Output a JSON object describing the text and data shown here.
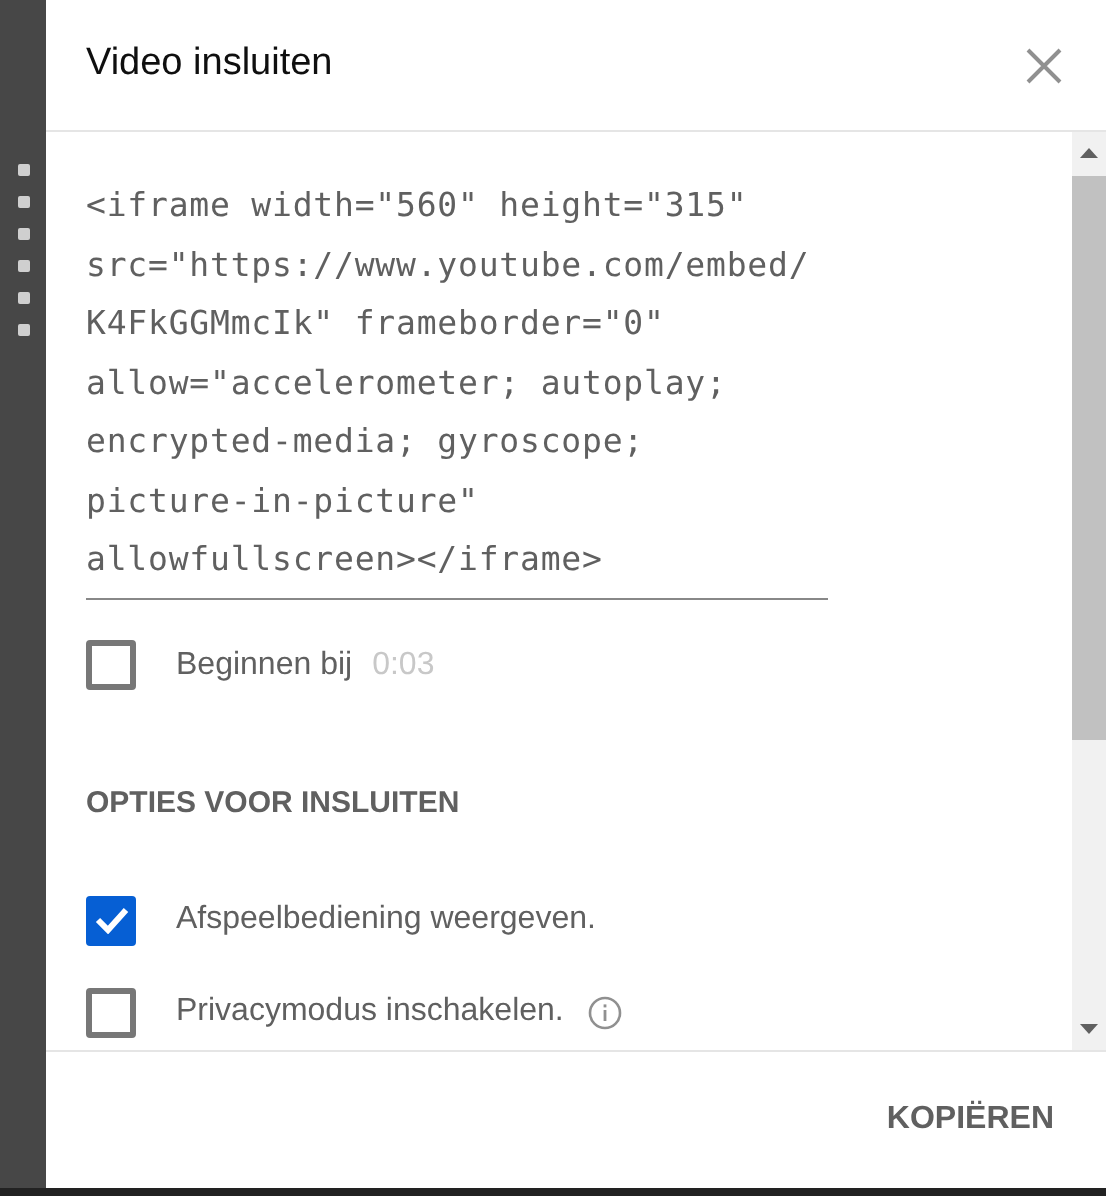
{
  "dialog": {
    "title": "Video insluiten"
  },
  "embed_code": {
    "lines": [
      "<iframe width=\"560\" height=\"315\"",
      "src=\"https://www.youtube.com/embed/",
      "K4FkGGMmcIk\" frameborder=\"0\"",
      "allow=\"accelerometer; autoplay;",
      "encrypted-media; gyroscope;",
      "picture-in-picture\"",
      "allowfullscreen></iframe>"
    ]
  },
  "start_at": {
    "label": "Beginnen bij",
    "checked": false,
    "placeholder": "0:03"
  },
  "options_heading": "OPTIES VOOR INSLUITEN",
  "options": [
    {
      "label": "Afspeelbediening weergeven.",
      "checked": true,
      "info": false
    },
    {
      "label": "Privacymodus inschakelen.",
      "checked": false,
      "info": true
    }
  ],
  "footer": {
    "button": "KOPIËREN"
  }
}
